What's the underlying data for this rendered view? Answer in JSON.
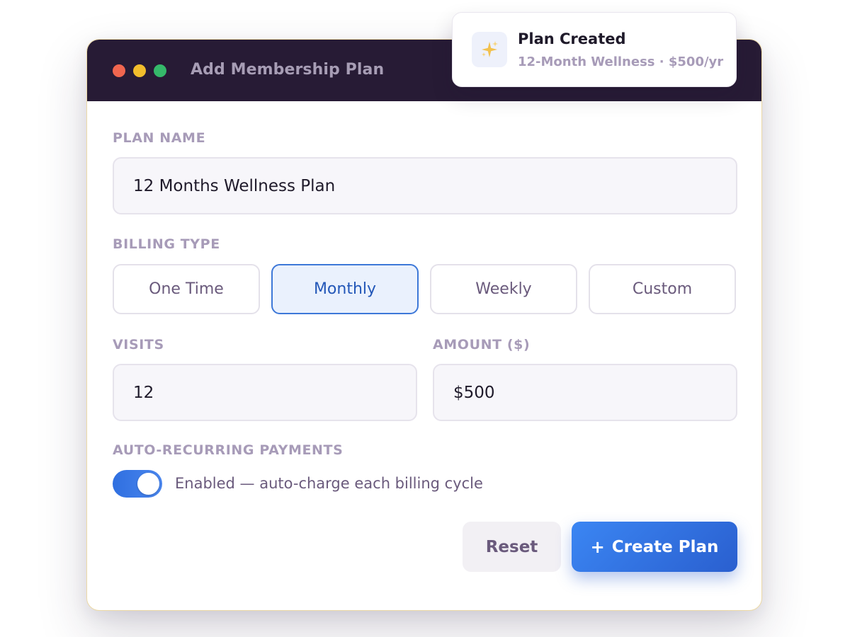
{
  "window": {
    "title": "Add Membership Plan"
  },
  "form": {
    "plan_name_label": "PLAN NAME",
    "plan_name_value": "12 Months Wellness Plan",
    "billing_type_label": "BILLING TYPE",
    "billing_options": [
      "One Time",
      "Monthly",
      "Weekly",
      "Custom"
    ],
    "billing_selected": "Monthly",
    "visits_label": "VISITS",
    "visits_value": "12",
    "amount_label": "AMOUNT ($)",
    "amount_value": "$500",
    "auto_recurring_label": "AUTO-RECURRING PAYMENTS",
    "auto_recurring_enabled": true,
    "auto_recurring_text": "Enabled — auto-charge each billing cycle"
  },
  "actions": {
    "reset_label": "Reset",
    "create_plus": "+",
    "create_label": "Create Plan"
  },
  "toast": {
    "icon": "sparkles-icon",
    "title": "Plan Created",
    "subtitle": "12-Month Wellness · $500/yr"
  },
  "colors": {
    "titlebar": "#271b35",
    "accent": "#3b86f3",
    "selected_border": "#3d78d8"
  }
}
